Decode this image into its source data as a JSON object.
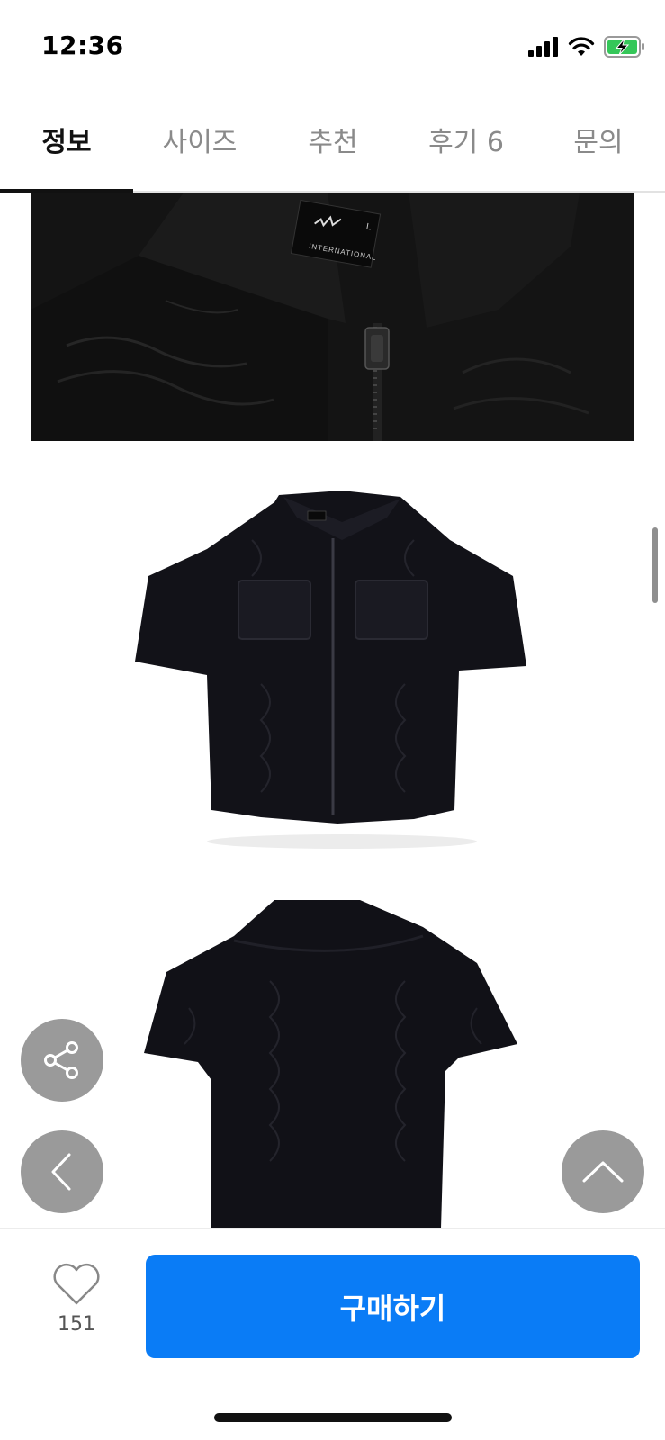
{
  "status_bar": {
    "time": "12:36",
    "icons": [
      "cellular-signal-icon",
      "wifi-icon",
      "battery-charging-icon"
    ]
  },
  "tabs": [
    {
      "label": "정보",
      "active": true
    },
    {
      "label": "사이즈",
      "active": false
    },
    {
      "label": "추천",
      "active": false
    },
    {
      "label": "후기 6",
      "active": false
    },
    {
      "label": "문의",
      "active": false
    }
  ],
  "product_images": [
    {
      "subject": "jacket collar and zipper closeup",
      "label_text": "INTERNATIONAL",
      "label_size": "L"
    },
    {
      "subject": "black short-sleeve zip jacket front view"
    },
    {
      "subject": "black short-sleeve zip jacket back view"
    }
  ],
  "floating_buttons": {
    "share": "share-icon",
    "back": "chevron-left-icon",
    "top": "chevron-up-icon"
  },
  "bottom_bar": {
    "like_count": "151",
    "buy_label": "구매하기"
  },
  "colors": {
    "accent": "#0a7cf6",
    "fab_gray": "#9a9a9a",
    "garment": "#151515"
  }
}
